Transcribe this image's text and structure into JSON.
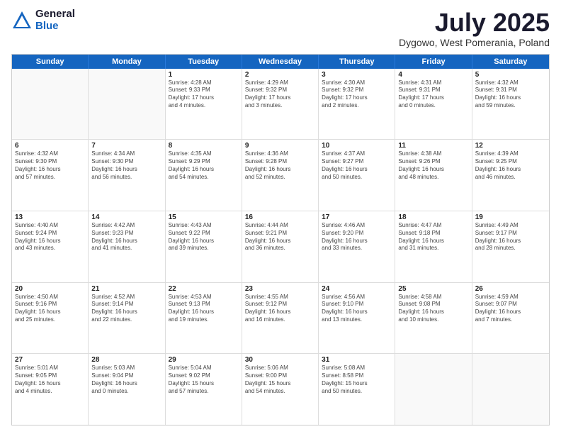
{
  "header": {
    "logo_general": "General",
    "logo_blue": "Blue",
    "title": "July 2025",
    "location": "Dygowo, West Pomerania, Poland"
  },
  "days_of_week": [
    "Sunday",
    "Monday",
    "Tuesday",
    "Wednesday",
    "Thursday",
    "Friday",
    "Saturday"
  ],
  "weeks": [
    [
      {
        "day": "",
        "info": ""
      },
      {
        "day": "",
        "info": ""
      },
      {
        "day": "1",
        "info": "Sunrise: 4:28 AM\nSunset: 9:33 PM\nDaylight: 17 hours\nand 4 minutes."
      },
      {
        "day": "2",
        "info": "Sunrise: 4:29 AM\nSunset: 9:32 PM\nDaylight: 17 hours\nand 3 minutes."
      },
      {
        "day": "3",
        "info": "Sunrise: 4:30 AM\nSunset: 9:32 PM\nDaylight: 17 hours\nand 2 minutes."
      },
      {
        "day": "4",
        "info": "Sunrise: 4:31 AM\nSunset: 9:31 PM\nDaylight: 17 hours\nand 0 minutes."
      },
      {
        "day": "5",
        "info": "Sunrise: 4:32 AM\nSunset: 9:31 PM\nDaylight: 16 hours\nand 59 minutes."
      }
    ],
    [
      {
        "day": "6",
        "info": "Sunrise: 4:32 AM\nSunset: 9:30 PM\nDaylight: 16 hours\nand 57 minutes."
      },
      {
        "day": "7",
        "info": "Sunrise: 4:34 AM\nSunset: 9:30 PM\nDaylight: 16 hours\nand 56 minutes."
      },
      {
        "day": "8",
        "info": "Sunrise: 4:35 AM\nSunset: 9:29 PM\nDaylight: 16 hours\nand 54 minutes."
      },
      {
        "day": "9",
        "info": "Sunrise: 4:36 AM\nSunset: 9:28 PM\nDaylight: 16 hours\nand 52 minutes."
      },
      {
        "day": "10",
        "info": "Sunrise: 4:37 AM\nSunset: 9:27 PM\nDaylight: 16 hours\nand 50 minutes."
      },
      {
        "day": "11",
        "info": "Sunrise: 4:38 AM\nSunset: 9:26 PM\nDaylight: 16 hours\nand 48 minutes."
      },
      {
        "day": "12",
        "info": "Sunrise: 4:39 AM\nSunset: 9:25 PM\nDaylight: 16 hours\nand 46 minutes."
      }
    ],
    [
      {
        "day": "13",
        "info": "Sunrise: 4:40 AM\nSunset: 9:24 PM\nDaylight: 16 hours\nand 43 minutes."
      },
      {
        "day": "14",
        "info": "Sunrise: 4:42 AM\nSunset: 9:23 PM\nDaylight: 16 hours\nand 41 minutes."
      },
      {
        "day": "15",
        "info": "Sunrise: 4:43 AM\nSunset: 9:22 PM\nDaylight: 16 hours\nand 39 minutes."
      },
      {
        "day": "16",
        "info": "Sunrise: 4:44 AM\nSunset: 9:21 PM\nDaylight: 16 hours\nand 36 minutes."
      },
      {
        "day": "17",
        "info": "Sunrise: 4:46 AM\nSunset: 9:20 PM\nDaylight: 16 hours\nand 33 minutes."
      },
      {
        "day": "18",
        "info": "Sunrise: 4:47 AM\nSunset: 9:18 PM\nDaylight: 16 hours\nand 31 minutes."
      },
      {
        "day": "19",
        "info": "Sunrise: 4:49 AM\nSunset: 9:17 PM\nDaylight: 16 hours\nand 28 minutes."
      }
    ],
    [
      {
        "day": "20",
        "info": "Sunrise: 4:50 AM\nSunset: 9:16 PM\nDaylight: 16 hours\nand 25 minutes."
      },
      {
        "day": "21",
        "info": "Sunrise: 4:52 AM\nSunset: 9:14 PM\nDaylight: 16 hours\nand 22 minutes."
      },
      {
        "day": "22",
        "info": "Sunrise: 4:53 AM\nSunset: 9:13 PM\nDaylight: 16 hours\nand 19 minutes."
      },
      {
        "day": "23",
        "info": "Sunrise: 4:55 AM\nSunset: 9:12 PM\nDaylight: 16 hours\nand 16 minutes."
      },
      {
        "day": "24",
        "info": "Sunrise: 4:56 AM\nSunset: 9:10 PM\nDaylight: 16 hours\nand 13 minutes."
      },
      {
        "day": "25",
        "info": "Sunrise: 4:58 AM\nSunset: 9:08 PM\nDaylight: 16 hours\nand 10 minutes."
      },
      {
        "day": "26",
        "info": "Sunrise: 4:59 AM\nSunset: 9:07 PM\nDaylight: 16 hours\nand 7 minutes."
      }
    ],
    [
      {
        "day": "27",
        "info": "Sunrise: 5:01 AM\nSunset: 9:05 PM\nDaylight: 16 hours\nand 4 minutes."
      },
      {
        "day": "28",
        "info": "Sunrise: 5:03 AM\nSunset: 9:04 PM\nDaylight: 16 hours\nand 0 minutes."
      },
      {
        "day": "29",
        "info": "Sunrise: 5:04 AM\nSunset: 9:02 PM\nDaylight: 15 hours\nand 57 minutes."
      },
      {
        "day": "30",
        "info": "Sunrise: 5:06 AM\nSunset: 9:00 PM\nDaylight: 15 hours\nand 54 minutes."
      },
      {
        "day": "31",
        "info": "Sunrise: 5:08 AM\nSunset: 8:58 PM\nDaylight: 15 hours\nand 50 minutes."
      },
      {
        "day": "",
        "info": ""
      },
      {
        "day": "",
        "info": ""
      }
    ]
  ]
}
